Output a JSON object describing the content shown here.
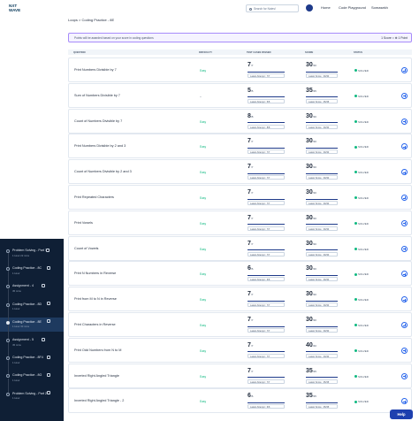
{
  "brand": {
    "line1": "NXT",
    "line2": "WAVE"
  },
  "header": {
    "search_placeholder": "Search for Notes!",
    "nav": [
      "Home",
      "Code Playground"
    ],
    "user": "Somasekh"
  },
  "breadcrumb": "Loops > Coding Practice - 8E",
  "banner": {
    "message": "Points will be awarded based on your score in coding questions",
    "points": "1 Score = ⊕ 1 Point"
  },
  "table": {
    "headers": [
      "Question",
      "Difficulty",
      "Test Cases Passed",
      "Score",
      "Status"
    ],
    "rows": [
      {
        "question": "Print Numbers Divisible by 7",
        "difficulty": "Easy",
        "tc": "7",
        "tc_total": "/7",
        "tc_fill": 1.0,
        "latest_tc": "Latest Attempt : 7/7",
        "score": "30",
        "score_total": "/30",
        "score_fill": 1.0,
        "latest_score": "Latest Score : 30/30",
        "status": "SOLVED"
      },
      {
        "question": "Sum of Numbers Divisible by 7",
        "difficulty": "–",
        "tc": "5",
        "tc_total": "/5",
        "tc_fill": 1.0,
        "latest_tc": "Latest Attempt : 5/5",
        "score": "35",
        "score_total": "/35",
        "score_fill": 1.0,
        "latest_score": "Latest Score : 35/35",
        "status": "SOLVED"
      },
      {
        "question": "Count of Numbers Divisible by 7",
        "difficulty": "Easy",
        "tc": "8",
        "tc_total": "/8",
        "tc_fill": 1.0,
        "latest_tc": "Latest Attempt : 8/8",
        "score": "30",
        "score_total": "/30",
        "score_fill": 1.0,
        "latest_score": "Latest Score : 30/30",
        "status": "SOLVED"
      },
      {
        "question": "Print Numbers Divisible by 2 and 3",
        "difficulty": "Easy",
        "tc": "7",
        "tc_total": "/7",
        "tc_fill": 1.0,
        "latest_tc": "Latest Attempt : 7/7",
        "score": "30",
        "score_total": "/30",
        "score_fill": 1.0,
        "latest_score": "Latest Score : 30/30",
        "status": "SOLVED"
      },
      {
        "question": "Count of Numbers Divisible by 2 and 3",
        "difficulty": "Easy",
        "tc": "7",
        "tc_total": "/7",
        "tc_fill": 1.0,
        "latest_tc": "Latest Attempt : 7/7",
        "score": "30",
        "score_total": "/30",
        "score_fill": 1.0,
        "latest_score": "Latest Score : 30/30",
        "status": "SOLVED"
      },
      {
        "question": "Print Repeated Characters",
        "difficulty": "Easy",
        "tc": "7",
        "tc_total": "/7",
        "tc_fill": 1.0,
        "latest_tc": "Latest Attempt : 7/7",
        "score": "30",
        "score_total": "/30",
        "score_fill": 1.0,
        "latest_score": "Latest Score : 30/30",
        "status": "SOLVED"
      },
      {
        "question": "Print Vowels",
        "difficulty": "Easy",
        "tc": "7",
        "tc_total": "/7",
        "tc_fill": 1.0,
        "latest_tc": "Latest Attempt : 7/7",
        "score": "30",
        "score_total": "/30",
        "score_fill": 1.0,
        "latest_score": "Latest Score : 30/30",
        "status": "SOLVED"
      },
      {
        "question": "Count of Vowels",
        "difficulty": "Easy",
        "tc": "7",
        "tc_total": "/7",
        "tc_fill": 1.0,
        "latest_tc": "Latest Attempt : 7/7",
        "score": "30",
        "score_total": "/30",
        "score_fill": 1.0,
        "latest_score": "Latest Score : 30/30",
        "status": "SOLVED"
      },
      {
        "question": "Print N Numbers in Reverse",
        "difficulty": "Easy",
        "tc": "6",
        "tc_total": "/6",
        "tc_fill": 1.0,
        "latest_tc": "Latest Attempt : 6/6",
        "score": "30",
        "score_total": "/30",
        "score_fill": 1.0,
        "latest_score": "Latest Score : 30/30",
        "status": "SOLVED"
      },
      {
        "question": "Print from M to N in Reverse",
        "difficulty": "Easy",
        "tc": "7",
        "tc_total": "/7",
        "tc_fill": 1.0,
        "latest_tc": "Latest Attempt : 7/7",
        "score": "30",
        "score_total": "/30",
        "score_fill": 1.0,
        "latest_score": "Latest Score : 30/30",
        "status": "SOLVED"
      },
      {
        "question": "Print Characters in Reverse",
        "difficulty": "Easy",
        "tc": "7",
        "tc_total": "/7",
        "tc_fill": 1.0,
        "latest_tc": "Latest Attempt : 7/7",
        "score": "30",
        "score_total": "/30",
        "score_fill": 1.0,
        "latest_score": "Latest Score : 30/30",
        "status": "SOLVED"
      },
      {
        "question": "Print Odd Numbers from N to M",
        "difficulty": "Easy",
        "tc": "7",
        "tc_total": "/7",
        "tc_fill": 1.0,
        "latest_tc": "Latest Attempt : 7/7",
        "score": "40",
        "score_total": "/40",
        "score_fill": 1.0,
        "latest_score": "Latest Score : 40/40",
        "status": "SOLVED"
      },
      {
        "question": "Inverted Right Angled Triangle",
        "difficulty": "Easy",
        "tc": "7",
        "tc_total": "/7",
        "tc_fill": 1.0,
        "latest_tc": "Latest Attempt : 7/7",
        "score": "35",
        "score_total": "/35",
        "score_fill": 1.0,
        "latest_score": "Latest Score : 35/35",
        "status": "SOLVED"
      },
      {
        "question": "Inverted Right Angled Triangle - 2",
        "difficulty": "Easy",
        "tc": "6",
        "tc_total": "/6",
        "tc_fill": 1.0,
        "latest_tc": "Latest Attempt : 6/6",
        "score": "35",
        "score_total": "/35",
        "score_fill": 1.0,
        "latest_score": "Latest Score : 35/35",
        "status": "SOLVED"
      }
    ]
  },
  "sidebar": {
    "items": [
      {
        "title": "Problem Solving - Part 1",
        "sub": "1 Hour 22 mins",
        "active": false
      },
      {
        "title": "Coding Practice - 8C",
        "sub": "1 Hour",
        "active": false
      },
      {
        "title": "Assignment - 4",
        "sub": "45 mins",
        "active": false
      },
      {
        "title": "Coding Practice - 8D",
        "sub": "1 Hour",
        "active": false
      },
      {
        "title": "Coding Practice - 8E",
        "sub": "1 Hour 30 mins",
        "active": true
      },
      {
        "title": "Assignment - 5",
        "sub": "45 mins",
        "active": false
      },
      {
        "title": "Coding Practice - 8F4",
        "sub": "1 Hour",
        "active": false
      },
      {
        "title": "Coding Practice - 8G",
        "sub": "1 Hour",
        "active": false
      },
      {
        "title": "Problem Solving - Part 2",
        "sub": "1 Hour",
        "active": false
      }
    ]
  },
  "help": "Help",
  "colors": {
    "accent": "#1e3a8a",
    "easy": "#10b981",
    "sidebar": "#0f1f35",
    "banner_border": "#a78bfa"
  }
}
